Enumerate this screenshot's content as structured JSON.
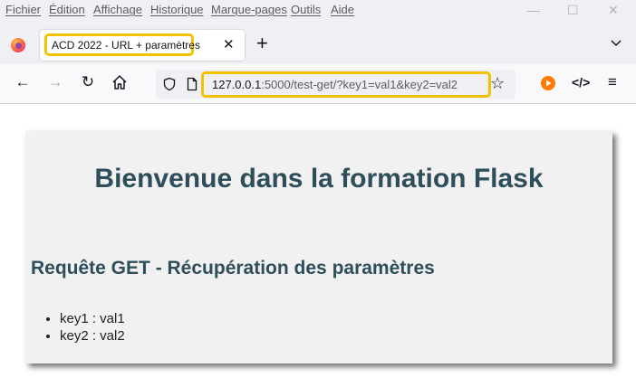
{
  "menubar": {
    "items": [
      "Fichier",
      "Édition",
      "Affichage",
      "Historique",
      "Marque-pages",
      "Outils",
      "Aide"
    ]
  },
  "tab": {
    "title": "ACD 2022 - URL + paramètres"
  },
  "address": {
    "host": "127.0.0.1",
    "rest": ":5000/test-get/?key1=val1&key2=val2"
  },
  "page": {
    "heading": "Bienvenue dans la formation Flask",
    "subheading": "Requête GET - Récupération des paramètres",
    "params": [
      "key1 : val1",
      "key2 : val2"
    ]
  },
  "colors": {
    "highlight": "#f2c200",
    "heading": "#2e4e5b"
  },
  "icons": [
    "firefox-logo",
    "back-arrow",
    "forward-arrow",
    "reload",
    "home",
    "shield",
    "page",
    "star",
    "media-play",
    "dev-tools",
    "hamburger-menu",
    "minimize",
    "maximize",
    "close",
    "plus",
    "chevron-down"
  ]
}
